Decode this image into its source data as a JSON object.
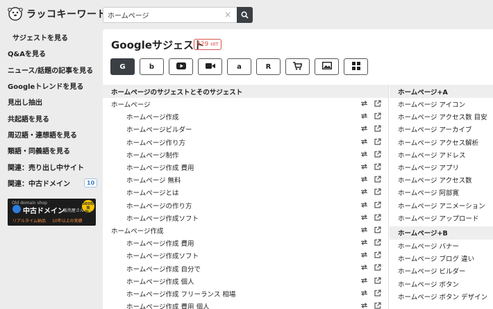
{
  "header": {
    "logo_text": "ラッコキーワード",
    "search_value": "ホームページ",
    "clear_glyph": "×"
  },
  "sidebar": {
    "items": [
      {
        "label": "サジェストを見る"
      },
      {
        "label": "Q&Aを見る"
      },
      {
        "label": "ニュース/話題の記事を見る"
      },
      {
        "label": "Googleトレンドを見る"
      },
      {
        "label": "見出し抽出"
      },
      {
        "label": "共起語を見る"
      },
      {
        "label": "周辺語・連想語を見る"
      },
      {
        "label": "類語・同義語を見る"
      },
      {
        "label": "関連：売り出し中サイト"
      },
      {
        "label": "関連：中古ドメイン",
        "badge": "10"
      }
    ],
    "banner": {
      "line1": "Old domain shop",
      "line2": "中古ドメイン",
      "line2_sub": "販売屋さん",
      "line3": "リアルタイム納品",
      "line4": "10年以上の実績",
      "seal": "SEO対策",
      "seal2": "強い"
    }
  },
  "main": {
    "title": "Googleサジェスト",
    "hit_count": "929",
    "hit_unit": "HIT",
    "engines": [
      {
        "name": "google",
        "glyph": "G"
      },
      {
        "name": "bing",
        "glyph": "b"
      },
      {
        "name": "youtube",
        "glyph": "▶"
      },
      {
        "name": "video",
        "glyph": "■"
      },
      {
        "name": "amazon",
        "glyph": "a"
      },
      {
        "name": "rakuten",
        "glyph": "R"
      },
      {
        "name": "shopping",
        "glyph": "🛒"
      },
      {
        "name": "image",
        "glyph": "▣"
      },
      {
        "name": "apps",
        "glyph": "⊞"
      }
    ],
    "left_header": "ホームページのサジェストとそのサジェスト",
    "left_rows": [
      {
        "text": "ホームページ",
        "level": "parent"
      },
      {
        "text": "ホームページ作成",
        "level": "child"
      },
      {
        "text": "ホームページビルダー",
        "level": "child"
      },
      {
        "text": "ホームページ作り方",
        "level": "child"
      },
      {
        "text": "ホームページ制作",
        "level": "child"
      },
      {
        "text": "ホームページ作成 費用",
        "level": "child"
      },
      {
        "text": "ホームページ 無料",
        "level": "child"
      },
      {
        "text": "ホームページとは",
        "level": "child"
      },
      {
        "text": "ホームページの作り方",
        "level": "child"
      },
      {
        "text": "ホームページ作成ソフト",
        "level": "child"
      },
      {
        "text": "ホームページ作成",
        "level": "parent"
      },
      {
        "text": "ホームページ作成 費用",
        "level": "child"
      },
      {
        "text": "ホームページ作成ソフト",
        "level": "child"
      },
      {
        "text": "ホームページ作成 自分で",
        "level": "child"
      },
      {
        "text": "ホームページ作成 個人",
        "level": "child"
      },
      {
        "text": "ホームページ作成 フリーランス 相場",
        "level": "child"
      },
      {
        "text": "ホームページ作成 費用 個人",
        "level": "child"
      }
    ],
    "right_header_a": "ホームページ+A",
    "right_rows_a": [
      "ホームページ アイコン",
      "ホームページ アクセス数 目安",
      "ホームページ アーカイブ",
      "ホームページ アクセス解析",
      "ホームページ アドレス",
      "ホームページ アプリ",
      "ホームページ アクセス数",
      "ホームページ 阿部寛",
      "ホームページ アニメーション",
      "ホームページ アップロード"
    ],
    "right_header_b": "ホームページ+B",
    "right_rows_b": [
      "ホームページ バナー",
      "ホームページ ブログ 違い",
      "ホームページ ビルダー",
      "ホームページ ボタン",
      "ホームページ ボタン デザイン"
    ]
  }
}
